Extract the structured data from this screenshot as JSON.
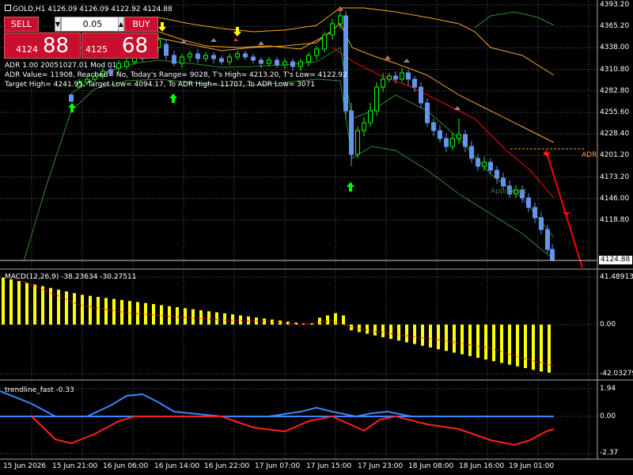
{
  "header": {
    "symbol_line": "GOLD,H1  4126.09 4126.09 4122.92 4124.88"
  },
  "trade_panel": {
    "sell_label": "SELL",
    "buy_label": "BUY",
    "volume": "0.05",
    "sell_small": "4124",
    "sell_big": "88",
    "buy_small": "4125",
    "buy_big": "68"
  },
  "adr_text": {
    "line1": "ADR 1.00 20051027.01 Mod 01",
    "line2": "ADR Value= 11908, Reached= No, Today's Range= 9028, T's High= 4213.20, T's Low= 4122.92",
    "line3": "Target High= 4241.95, Target Low= 4094.17, To ADR High= 11707, To ADR Low= 3071",
    "adr_label": "ADR",
    "apps_label": "AppnStart"
  },
  "price_axis": [
    "4393.20",
    "4365.20",
    "4338.00",
    "4310.80",
    "4282.80",
    "4255.60",
    "4228.40",
    "4201.20",
    "4173.20",
    "4146.00",
    "4118.80"
  ],
  "current_price": "4124.88",
  "macd": {
    "label": "MACD(12,26,9) -38.23634 -30.27511",
    "axis": [
      "41.48913",
      "0.00",
      "-42.03279"
    ]
  },
  "trendline": {
    "label": "trendline_fast -0.33",
    "axis": [
      "1.94",
      "0.00",
      "-2.37"
    ]
  },
  "time_axis": [
    "15 Jun 2026",
    "15 Jun 21:00",
    "16 Jun 06:00",
    "16 Jun 14:00",
    "16 Jun 22:00",
    "17 Jun 07:00",
    "17 Jun 15:00",
    "17 Jun 23:00",
    "18 Jun 08:00",
    "18 Jun 16:00",
    "19 Jun 01:00"
  ],
  "colors": {
    "bull": "#00ff00",
    "bear": "#6495ed",
    "macd_hist": "#ffff00",
    "signal": "#ff0000",
    "upper_band": "#f5a623",
    "lower_band": "#2e8b2e",
    "grid": "#5a5a5a"
  }
}
